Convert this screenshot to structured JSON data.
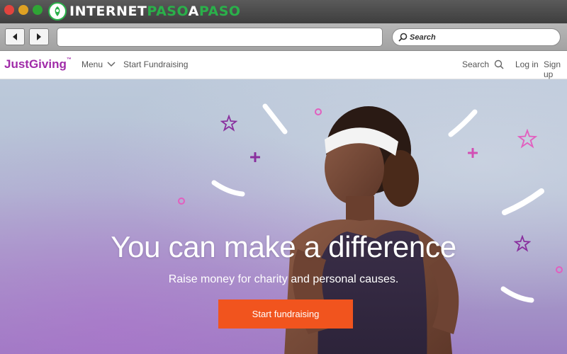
{
  "browser": {
    "watermark": {
      "part1": "INTERNET",
      "part2": "PASO",
      "part3": "A",
      "part4": "PASO"
    },
    "search_placeholder": "Search",
    "url": ""
  },
  "site": {
    "logo": "JustGiving",
    "nav": {
      "menu": "Menu",
      "start_fundraising": "Start Fundraising",
      "search": "Search",
      "login": "Log in",
      "signup": "Sign up"
    }
  },
  "hero": {
    "headline": "You can make a difference",
    "subline": "Raise money for charity and personal causes.",
    "cta": "Start fundraising"
  },
  "colors": {
    "brand_purple": "#a02ba8",
    "cta_orange": "#f1541e"
  }
}
